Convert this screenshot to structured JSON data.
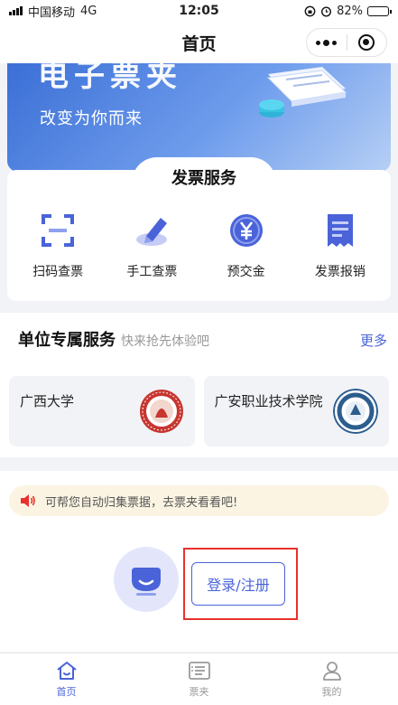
{
  "status": {
    "carrier": "中国移动",
    "network": "4G",
    "time": "12:05",
    "battery": "82%",
    "battery_level": 0.82
  },
  "nav": {
    "title": "首页"
  },
  "banner": {
    "headline": "电子票夹",
    "subtitle": "改变为你而来"
  },
  "services": {
    "title": "发票服务",
    "items": [
      {
        "label": "扫码查票",
        "icon": "scan-icon"
      },
      {
        "label": "手工查票",
        "icon": "pen-icon"
      },
      {
        "label": "预交金",
        "icon": "yen-coin-icon"
      },
      {
        "label": "发票报销",
        "icon": "receipt-icon"
      }
    ]
  },
  "unit": {
    "title": "单位专属服务",
    "subtitle": "快来抢先体验吧",
    "more": "更多",
    "items": [
      {
        "name": "广西大学",
        "logo": "guangxi-university-logo"
      },
      {
        "name": "广安职业技术学院",
        "logo": "guangan-vocational-college-logo"
      }
    ]
  },
  "notice": {
    "text": "可帮您自动归集票据，去票夹看看吧!"
  },
  "login": {
    "label": "登录/注册"
  },
  "tabbar": [
    {
      "label": "首页",
      "icon": "home-icon",
      "active": true
    },
    {
      "label": "票夹",
      "icon": "ticket-folder-icon",
      "active": false
    },
    {
      "label": "我的",
      "icon": "person-icon",
      "active": false
    }
  ],
  "colors": {
    "accent": "#4a63d9",
    "highlight_border": "#e8312d",
    "notice_bg": "#fbf4e3",
    "page_bg": "#f2f3f7"
  }
}
